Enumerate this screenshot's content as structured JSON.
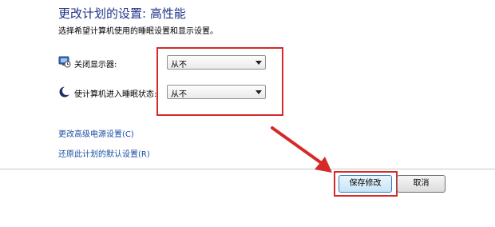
{
  "header": {
    "title": "更改计划的设置: 高性能",
    "subtitle": "选择希望计算机使用的睡眠设置和显示设置。"
  },
  "settings": {
    "display": {
      "icon": "monitor-clock-icon",
      "label": "关闭显示器:",
      "value": "从不"
    },
    "sleep": {
      "icon": "moon-icon",
      "label": "使计算机进入睡眠状态:",
      "value": "从不"
    }
  },
  "links": {
    "advanced": "更改高级电源设置(C)",
    "restore": "还原此计划的默认设置(R)"
  },
  "buttons": {
    "save": "保存修改",
    "cancel": "取消"
  },
  "colors": {
    "title": "#1e3287",
    "link": "#1a4fa5",
    "annotation": "#d42a2a"
  }
}
